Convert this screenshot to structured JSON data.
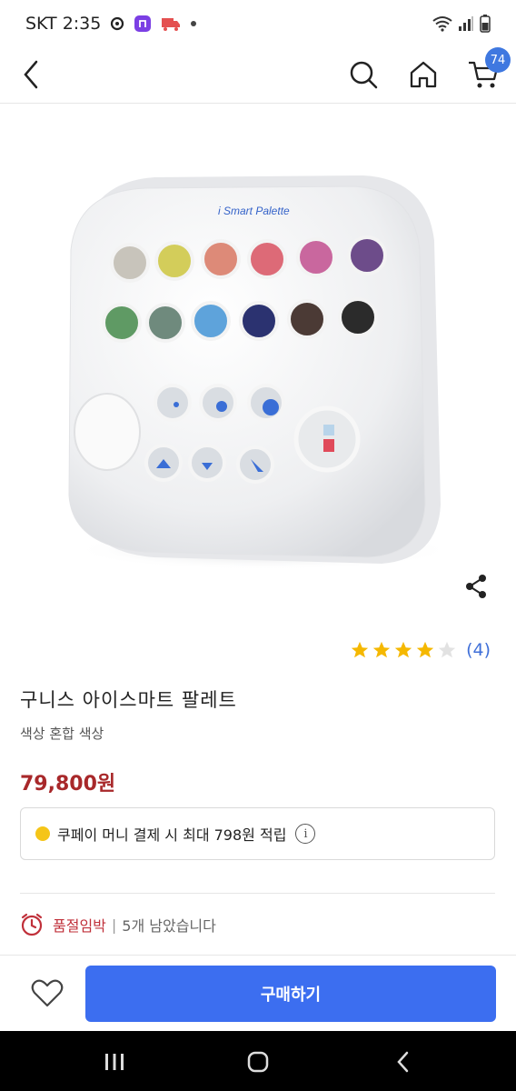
{
  "status_bar": {
    "carrier_time": "SKT 2:35",
    "icons": [
      "location-icon",
      "app-notification-icon",
      "delivery-icon",
      "dot-icon",
      "wifi-icon",
      "signal-icon",
      "battery-icon"
    ]
  },
  "header": {
    "icons": [
      "back-icon",
      "search-icon",
      "home-icon",
      "cart-icon"
    ],
    "cart_count": "74"
  },
  "product": {
    "image_label": "i Smart Palette",
    "rating_stars": 4,
    "rating_max": 5,
    "review_count": "(4)",
    "title": "구니스 아이스마트 팔레트",
    "option": "색상 혼합 색상",
    "price": "79,800원"
  },
  "coupon": {
    "text": "쿠페이 머니 결제 시 최대 798원 적립",
    "info_glyph": "i"
  },
  "stock": {
    "label": "품절임박",
    "separator": "|",
    "remaining": "5개 남았습니다"
  },
  "actions": {
    "buy_label": "구매하기"
  },
  "colors": {
    "accent": "#3c6ef0",
    "price": "#a8282a",
    "star": "#f5b800",
    "stock_alert": "#c0303a"
  }
}
